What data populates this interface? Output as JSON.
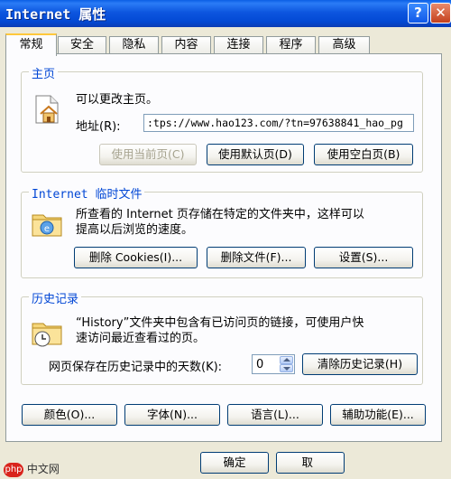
{
  "window": {
    "title": "Internet 属性",
    "help_glyph": "?",
    "close_glyph": "✕"
  },
  "tabs": [
    {
      "label": "常规",
      "active": true
    },
    {
      "label": "安全"
    },
    {
      "label": "隐私"
    },
    {
      "label": "内容"
    },
    {
      "label": "连接"
    },
    {
      "label": "程序"
    },
    {
      "label": "高级"
    }
  ],
  "home": {
    "legend": "主页",
    "description": "可以更改主页。",
    "address_label": "地址(R):",
    "address_value": ":tps://www.hao123.com/?tn=97638841_hao_pg",
    "buttons": {
      "use_current": "使用当前页(C)",
      "use_default": "使用默认页(D)",
      "use_blank": "使用空白页(B)"
    }
  },
  "temp_files": {
    "legend": "Internet 临时文件",
    "description_line1": "所查看的 Internet 页存储在特定的文件夹中，这样可以",
    "description_line2": "提高以后浏览的速度。",
    "buttons": {
      "delete_cookies": "删除 Cookies(I)...",
      "delete_files": "删除文件(F)...",
      "settings": "设置(S)..."
    }
  },
  "history": {
    "legend": "历史记录",
    "description_line1": "“History”文件夹中包含有已访问页的链接，可使用户快",
    "description_line2": "速访问最近查看过的页。",
    "days_label": "网页保存在历史记录中的天数(K):",
    "days_value": "0",
    "clear_button": "清除历史记录(H)"
  },
  "bottom_buttons": {
    "colors": "颜色(O)...",
    "fonts": "字体(N)...",
    "languages": "语言(L)...",
    "accessibility": "辅助功能(E)..."
  },
  "dialog_buttons": {
    "ok": "确定",
    "cancel": "取"
  },
  "watermark": {
    "logo": "php",
    "text": "中文网"
  },
  "colors": {
    "titlebar": "#0A5FE4",
    "background": "#ECE9D8",
    "legend": "#0046D5",
    "active_tab_accent": "#FFC83C"
  }
}
